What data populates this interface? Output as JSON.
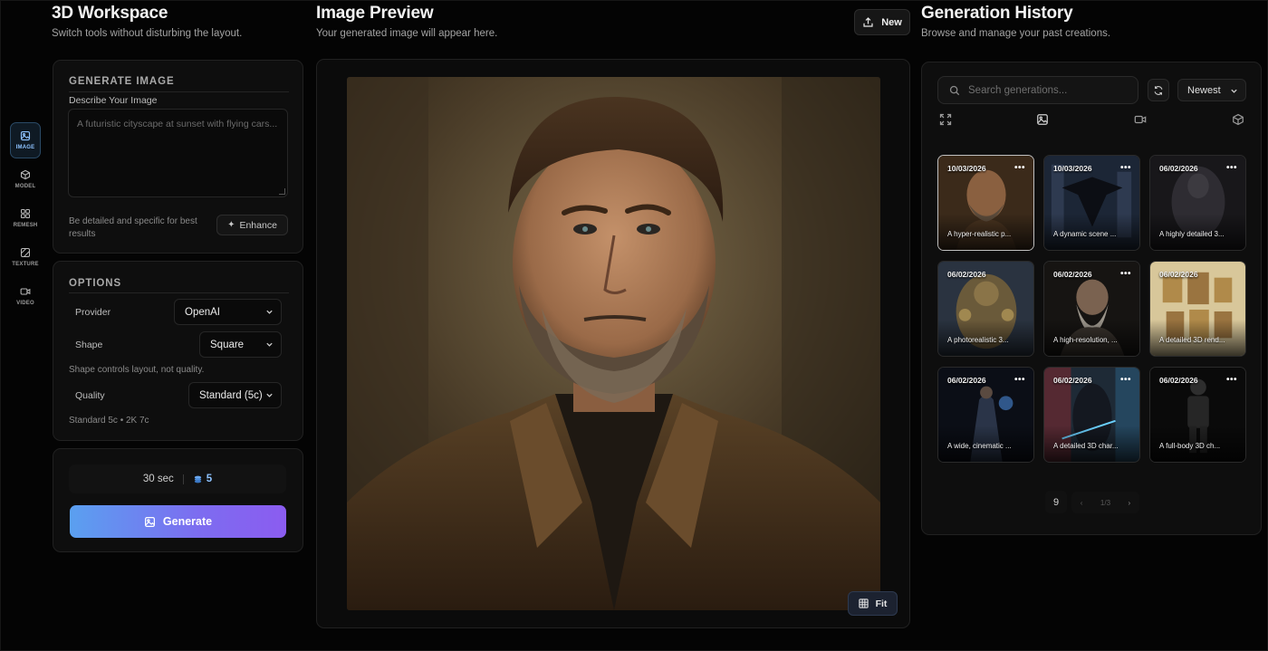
{
  "workspace": {
    "title": "3D Workspace",
    "subtitle": "Switch tools without disturbing the layout."
  },
  "rail": {
    "items": [
      {
        "label": "IMAGE",
        "icon": "image-icon",
        "active": true
      },
      {
        "label": "MODEL",
        "icon": "cube-icon",
        "active": false
      },
      {
        "label": "REMESH",
        "icon": "grid-icon",
        "active": false
      },
      {
        "label": "TEXTURE",
        "icon": "texture-icon",
        "active": false
      },
      {
        "label": "VIDEO",
        "icon": "video-icon",
        "active": false
      }
    ]
  },
  "generate": {
    "heading": "GENERATE IMAGE",
    "prompt_label": "Describe Your Image",
    "prompt_placeholder": "A futuristic cityscape at sunset with flying cars...",
    "hint": "Be detailed and specific for best results",
    "enhance_label": "Enhance"
  },
  "options": {
    "heading": "OPTIONS",
    "provider_label": "Provider",
    "provider_value": "OpenAI",
    "shape_label": "Shape",
    "shape_value": "Square",
    "shape_note": "Shape controls layout, not quality.",
    "quality_label": "Quality",
    "quality_value": "Standard (5c)",
    "quality_note": "Standard 5c • 2K 7c"
  },
  "run": {
    "time": "30 sec",
    "credits": "5",
    "generate_label": "Generate"
  },
  "preview": {
    "title": "Image Preview",
    "subtitle": "Your generated image will appear here.",
    "new_label": "New",
    "fit_label": "Fit"
  },
  "history": {
    "title": "Generation History",
    "subtitle": "Browse and manage your past creations.",
    "search_placeholder": "Search generations...",
    "sort_value": "Newest",
    "filters": [
      "expand-icon",
      "image-icon",
      "video-icon",
      "cube-icon"
    ],
    "items": [
      {
        "date": "10/03/2026",
        "caption": "A hyper-realistic p...",
        "palette": [
          "#5a4128",
          "#2b1f14"
        ],
        "selected": true
      },
      {
        "date": "10/03/2026",
        "caption": "A dynamic scene ...",
        "palette": [
          "#3a4a62",
          "#141b26"
        ],
        "selected": false
      },
      {
        "date": "06/02/2026",
        "caption": "A highly detailed 3...",
        "palette": [
          "#3c3a40",
          "#121114"
        ],
        "selected": false
      },
      {
        "date": "06/02/2026",
        "caption": "A photorealistic 3...",
        "palette": [
          "#6a5a3a",
          "#2a3340"
        ],
        "selected": false
      },
      {
        "date": "06/02/2026",
        "caption": "A high-resolution, ...",
        "palette": [
          "#4a4440",
          "#161412"
        ],
        "selected": false
      },
      {
        "date": "06/02/2026",
        "caption": "A detailed 3D rend...",
        "palette": [
          "#b08a4a",
          "#d8c79a"
        ],
        "selected": false
      },
      {
        "date": "06/02/2026",
        "caption": "A wide, cinematic ...",
        "palette": [
          "#1d2a40",
          "#0b0e16"
        ],
        "selected": false
      },
      {
        "date": "06/02/2026",
        "caption": "A detailed 3D char...",
        "palette": [
          "#7a2a30",
          "#1e3a4a"
        ],
        "selected": false
      },
      {
        "date": "06/02/2026",
        "caption": "A full-body 3D ch...",
        "palette": [
          "#2a2a2a",
          "#0a0a0a"
        ],
        "selected": false
      }
    ],
    "page_size": "9",
    "page_indicator": "1/3"
  },
  "colors": {
    "accent_start": "#5aa0f0",
    "accent_end": "#8b5cf0",
    "rail_active": "#8ec3ff"
  }
}
